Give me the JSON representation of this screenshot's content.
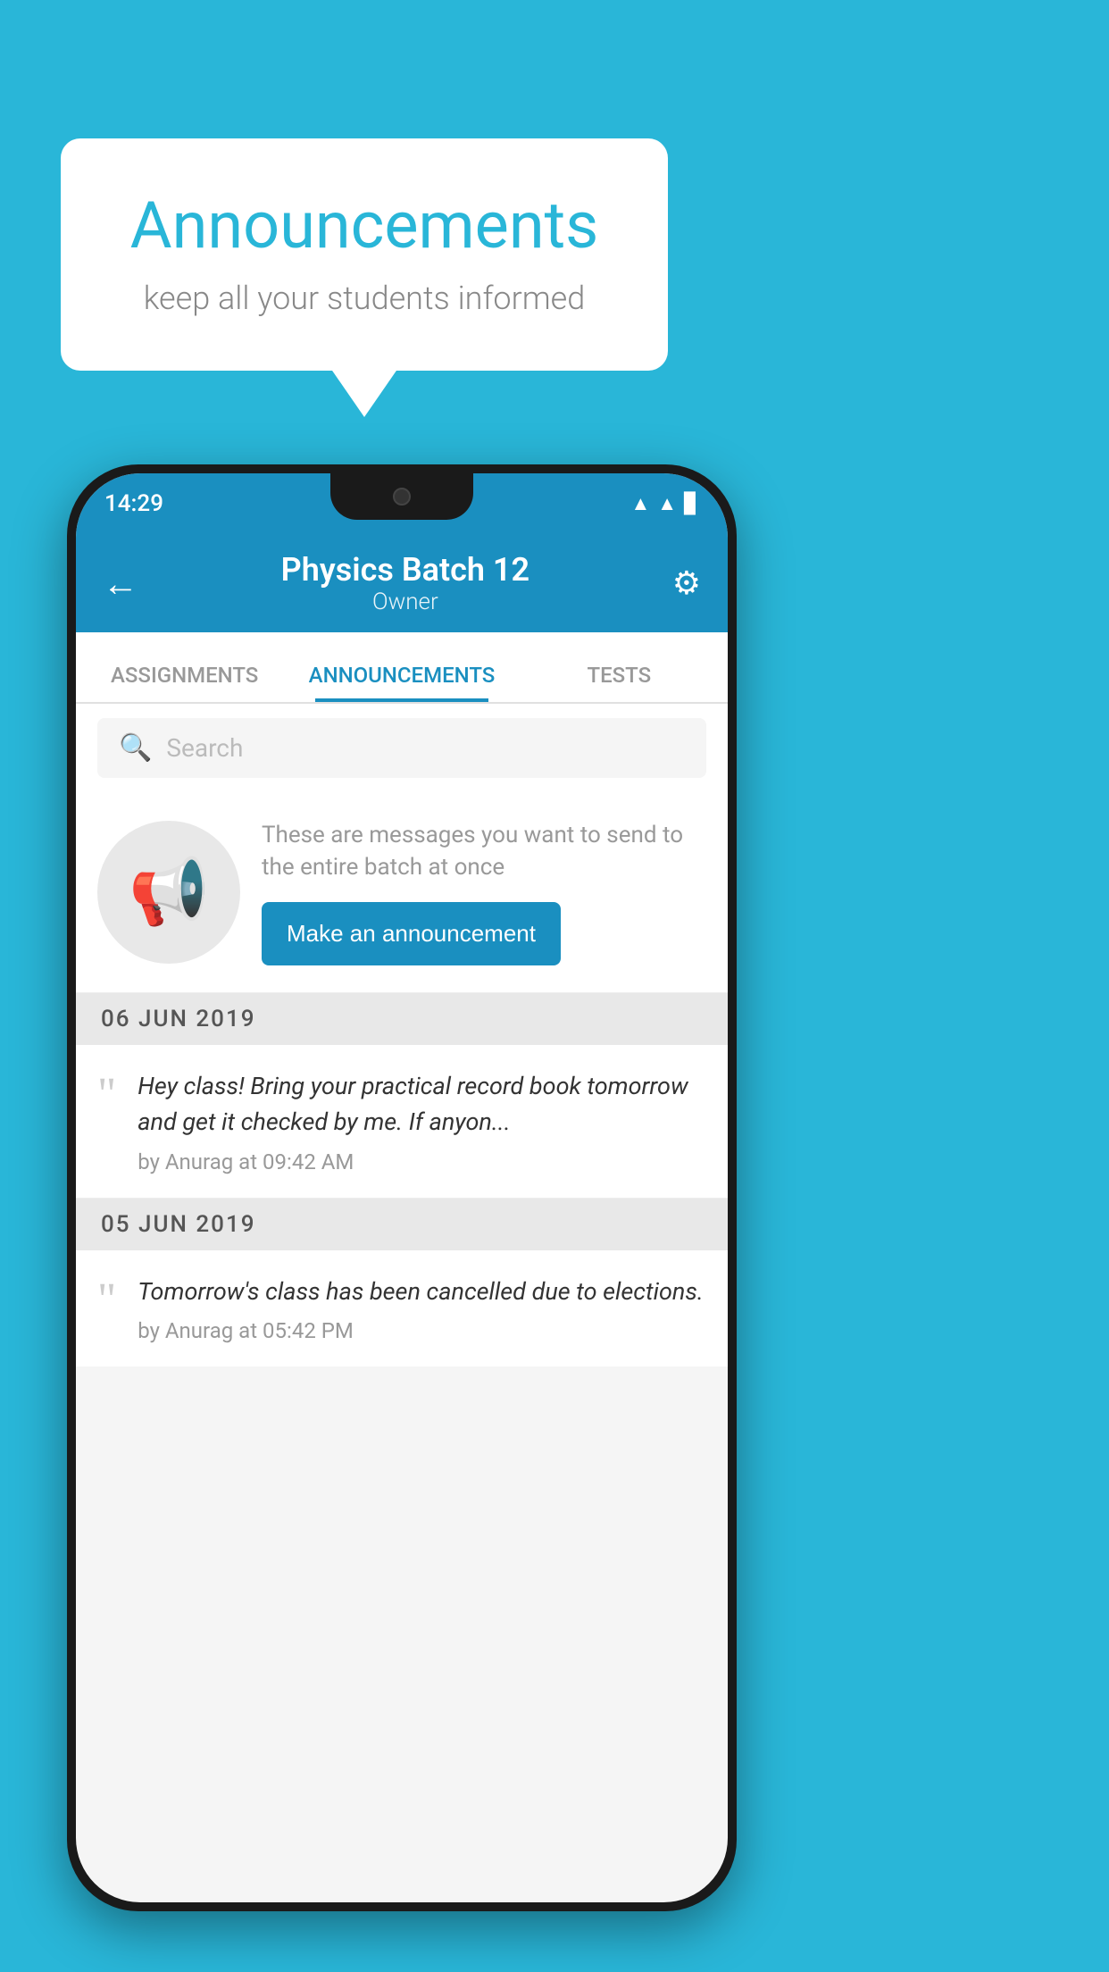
{
  "background": {
    "color": "#29b6d8"
  },
  "speech_bubble": {
    "title": "Announcements",
    "subtitle": "keep all your students informed"
  },
  "phone": {
    "status_bar": {
      "time": "14:29",
      "icons": [
        "wifi",
        "signal",
        "battery"
      ]
    },
    "app_bar": {
      "title": "Physics Batch 12",
      "subtitle": "Owner",
      "back_label": "←",
      "settings_label": "⚙"
    },
    "tabs": [
      {
        "label": "ASSIGNMENTS",
        "active": false
      },
      {
        "label": "ANNOUNCEMENTS",
        "active": true
      },
      {
        "label": "TESTS",
        "active": false
      }
    ],
    "search": {
      "placeholder": "Search"
    },
    "promo": {
      "description": "These are messages you want to send to the entire batch at once",
      "button_label": "Make an announcement"
    },
    "announcements": [
      {
        "date": "06  JUN  2019",
        "text": "Hey class! Bring your practical record book tomorrow and get it checked by me. If anyon...",
        "meta": "by Anurag at 09:42 AM"
      },
      {
        "date": "05  JUN  2019",
        "text": "Tomorrow's class has been cancelled due to elections.",
        "meta": "by Anurag at 05:42 PM"
      }
    ]
  }
}
